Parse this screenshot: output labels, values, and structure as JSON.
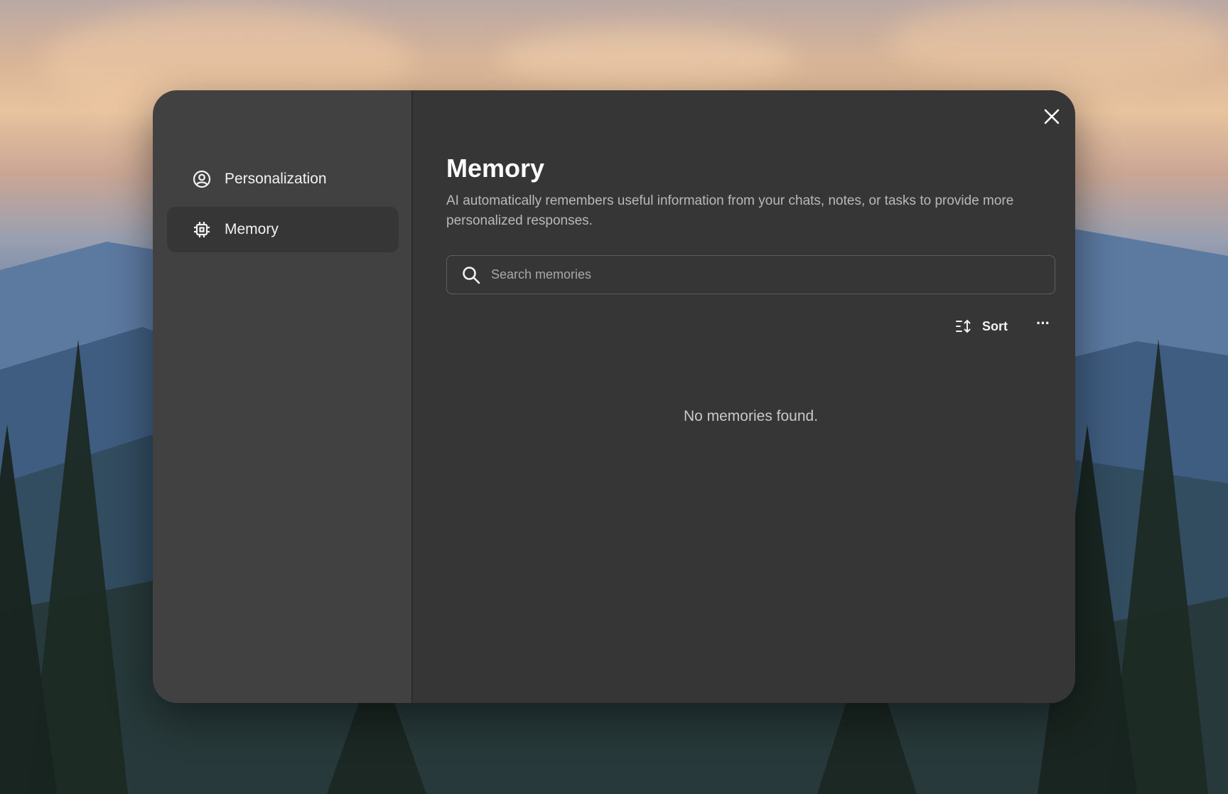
{
  "sidebar": {
    "items": [
      {
        "label": "Personalization",
        "icon": "user-circle-icon",
        "active": false
      },
      {
        "label": "Memory",
        "icon": "chip-icon",
        "active": true
      }
    ]
  },
  "main": {
    "title": "Memory",
    "description": "AI automatically remembers useful information from your chats, notes, or tasks to provide more personalized responses.",
    "search": {
      "placeholder": "Search memories",
      "value": ""
    },
    "toolbar": {
      "sort_label": "Sort",
      "more_label": "···"
    },
    "empty_state": "No memories found."
  },
  "colors": {
    "sidebar_bg": "#414141",
    "main_bg": "#363636",
    "active_item_bg": "#363636",
    "text_primary": "#ffffff",
    "text_secondary": "#b9b9b9"
  }
}
